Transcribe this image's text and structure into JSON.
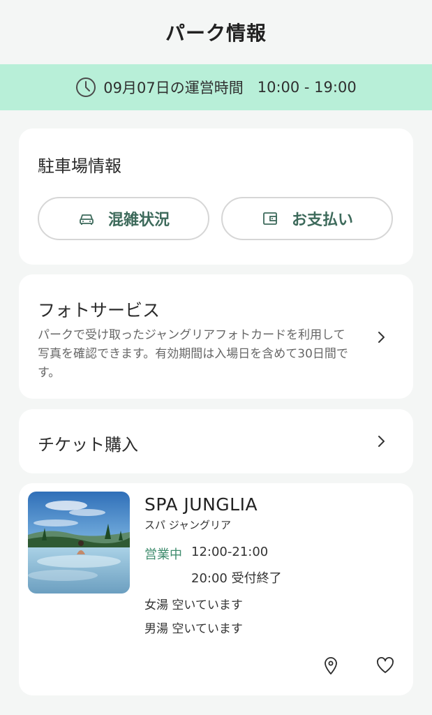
{
  "header": {
    "title": "パーク情報"
  },
  "hours_banner": {
    "icon": "clock-icon",
    "date_text": "09月07日の運営時間",
    "hours_text": "10:00 - 19:00",
    "background": "#b8efd8"
  },
  "parking": {
    "heading": "駐車場情報",
    "buttons": [
      {
        "label": "混雑状況",
        "icon": "car-icon"
      },
      {
        "label": "お支払い",
        "icon": "wallet-icon"
      }
    ],
    "accent": "#3d6a5b"
  },
  "photo_service": {
    "heading": "フォトサービス",
    "description": "パークで受け取ったジャングリアフォトカードを利用して写真を確認できます。有効期間は入場日を含めて30日間です。"
  },
  "ticket": {
    "heading": "チケット購入"
  },
  "spa": {
    "name": "SPA JUNGLIA",
    "kana": "スパ ジャングリア",
    "status": "営業中",
    "status_color": "#3f8c6e",
    "hours": "12:00-21:00",
    "last_entry": "20:00 受付終了",
    "womens_bath": "女湯 空いています",
    "mens_bath": "男湯 空いています",
    "thumbnail": "infinity-pool-photo",
    "actions": [
      "map-pin-icon",
      "heart-icon"
    ]
  }
}
